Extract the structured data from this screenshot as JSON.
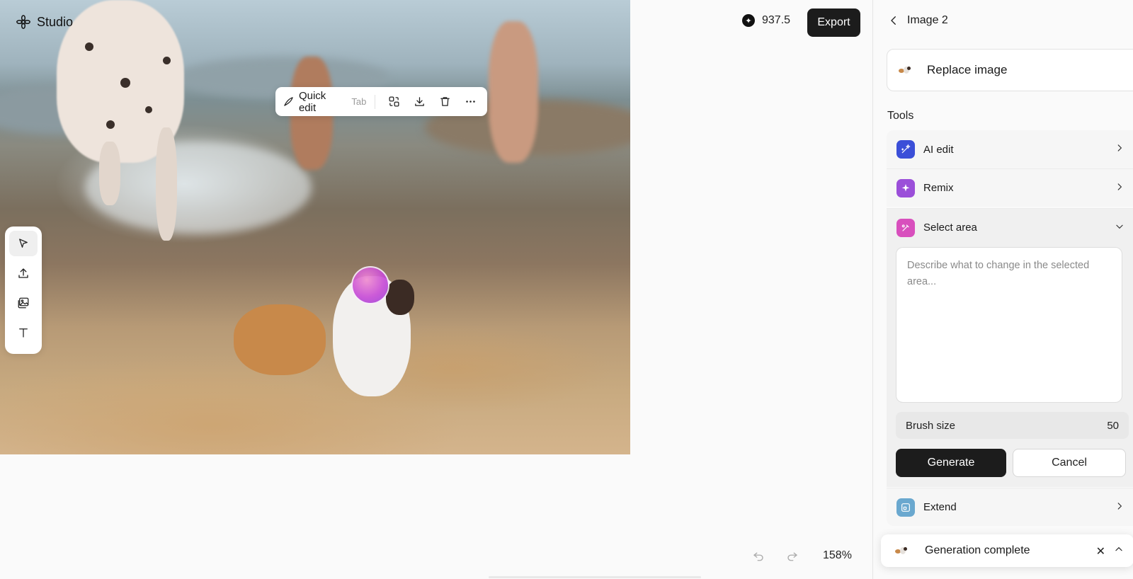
{
  "app": {
    "brand_name": "Studio",
    "brand_icon": "gear-flower-icon"
  },
  "canvas": {
    "image_alt": "Dalmatian running on beach with people, an orange cat and a white dog",
    "quick_toolbar": {
      "quick_edit_label": "Quick edit",
      "quick_edit_hint": "Tab",
      "icons": [
        "replace-icon",
        "download-icon",
        "trash-icon",
        "more-icon"
      ]
    },
    "rail_tools": [
      "select-pointer-icon",
      "upload-icon",
      "image-icon",
      "text-icon"
    ],
    "zoom": "158%"
  },
  "header": {
    "credits": "937.5",
    "export_label": "Export"
  },
  "panel": {
    "title": "Image 2",
    "replace_label": "Replace image",
    "tools_label": "Tools",
    "tools": [
      {
        "label": "AI edit",
        "color": "#3b4fd8"
      },
      {
        "label": "Remix",
        "color": "#9b4fd9"
      },
      {
        "label": "Select area",
        "color": "#d84fbd"
      },
      {
        "label": "Extend",
        "color": "#6aa8cf"
      }
    ],
    "prompt_placeholder": "Describe what to change in the selected area...",
    "brush_label": "Brush size",
    "brush_value": "50",
    "generate_label": "Generate",
    "cancel_label": "Cancel",
    "toast_text": "Generation complete"
  }
}
